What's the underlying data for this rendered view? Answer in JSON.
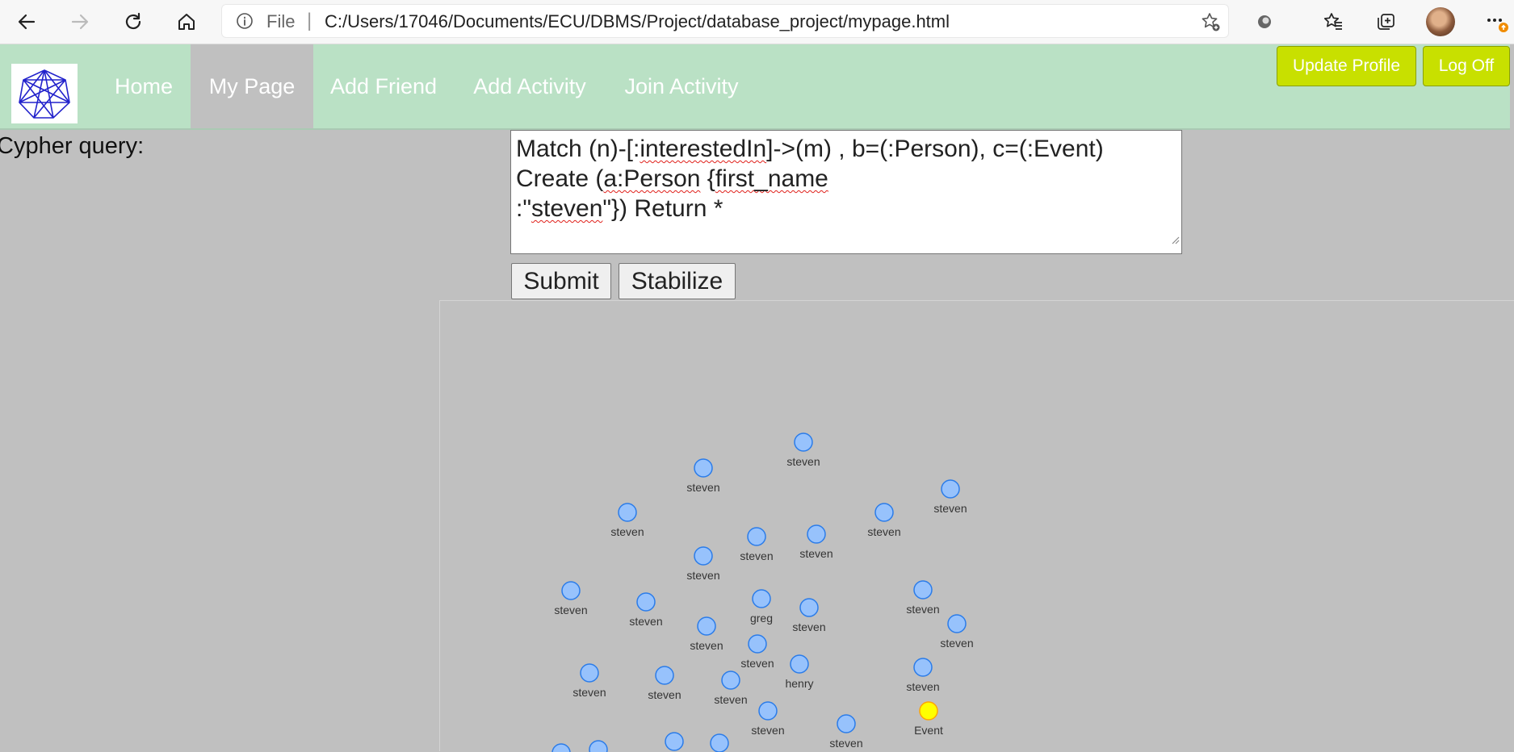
{
  "browser": {
    "file_label": "File",
    "url": "C:/Users/17046/Documents/ECU/DBMS/Project/database_project/mypage.html"
  },
  "nav": {
    "items": [
      {
        "label": "Home",
        "active": false
      },
      {
        "label": "My Page",
        "active": true
      },
      {
        "label": "Add Friend",
        "active": false
      },
      {
        "label": "Add Activity",
        "active": false
      },
      {
        "label": "Join Activity",
        "active": false
      }
    ],
    "update_profile": "Update Profile",
    "log_off": "Log Off"
  },
  "query": {
    "label": "Cypher query:",
    "line1_a": "Match (n)-[:",
    "line1_b": "interestedIn",
    "line1_c": "]->(m) , b=(:Person), c=(:Event)",
    "line2_a": "Create (",
    "line2_b": "a:Person",
    "line2_c": " {",
    "line2_d": "first_name",
    "line3_a": ":\"",
    "line3_b": "steven",
    "line3_c": "\"}) Return *",
    "submit": "Submit",
    "stabilize": "Stabilize"
  },
  "graph": {
    "colors": {
      "person": "#97c2fc",
      "person_border": "#2b7ce9",
      "event": "#ffff00",
      "event_border": "#ffa500"
    },
    "nodes": [
      {
        "label": "steven",
        "type": "person"
      },
      {
        "label": "steven",
        "type": "person"
      },
      {
        "label": "steven",
        "type": "person"
      },
      {
        "label": "steven",
        "type": "person"
      },
      {
        "label": "steven",
        "type": "person"
      },
      {
        "label": "steven",
        "type": "person"
      },
      {
        "label": "steven",
        "type": "person"
      },
      {
        "label": "steven",
        "type": "person"
      },
      {
        "label": "steven",
        "type": "person"
      },
      {
        "label": "steven",
        "type": "person"
      },
      {
        "label": "greg",
        "type": "person"
      },
      {
        "label": "steven",
        "type": "person"
      },
      {
        "label": "steven",
        "type": "person"
      },
      {
        "label": "steven",
        "type": "person"
      },
      {
        "label": "steven",
        "type": "person"
      },
      {
        "label": "steven",
        "type": "person"
      },
      {
        "label": "steven",
        "type": "person"
      },
      {
        "label": "steven",
        "type": "person"
      },
      {
        "label": "henry",
        "type": "person"
      },
      {
        "label": "steven",
        "type": "person"
      },
      {
        "label": "steven",
        "type": "person"
      },
      {
        "label": "steven",
        "type": "person"
      },
      {
        "label": "steven",
        "type": "person"
      },
      {
        "label": "steven",
        "type": "person"
      },
      {
        "label": "Event",
        "type": "event"
      },
      {
        "label": "",
        "type": "person"
      },
      {
        "label": "",
        "type": "person"
      },
      {
        "label": "",
        "type": "person"
      }
    ]
  }
}
